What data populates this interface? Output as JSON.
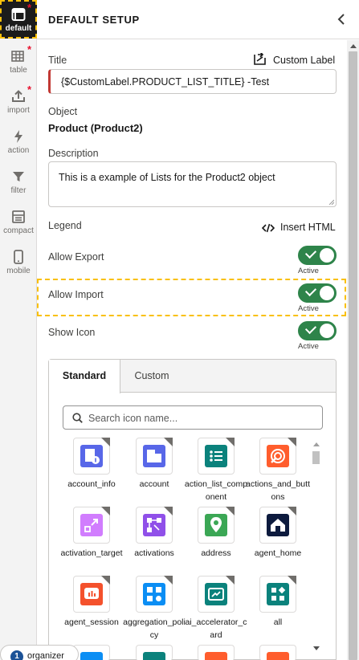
{
  "rail": {
    "items": [
      {
        "label": "default",
        "icon": "layout-icon",
        "active": true,
        "starred": true
      },
      {
        "label": "table",
        "icon": "table-icon",
        "starred": true
      },
      {
        "label": "import",
        "icon": "upload-icon",
        "starred": true
      },
      {
        "label": "action",
        "icon": "bolt-icon"
      },
      {
        "label": "filter",
        "icon": "filter-icon"
      },
      {
        "label": "compact",
        "icon": "compact-icon"
      },
      {
        "label": "mobile",
        "icon": "mobile-icon"
      }
    ]
  },
  "header": {
    "title": "DEFAULT SETUP"
  },
  "title_field": {
    "label": "Title",
    "custom_label_link": "Custom Label",
    "value": "{$CustomLabel.PRODUCT_LIST_TITLE} -Test"
  },
  "object": {
    "label": "Object",
    "value": "Product (Product2)"
  },
  "description": {
    "label": "Description",
    "value": "This is a example of Lists for the Product2 object"
  },
  "legend": {
    "label": "Legend",
    "insert_html": "Insert HTML"
  },
  "toggles": [
    {
      "label": "Allow Export",
      "status": "Active"
    },
    {
      "label": "Allow Import",
      "status": "Active"
    },
    {
      "label": "Show Icon",
      "status": "Active"
    }
  ],
  "icon_picker": {
    "tabs": [
      "Standard",
      "Custom"
    ],
    "search_placeholder": "Search icon name...",
    "icons": [
      {
        "name": "account_info",
        "color": "#5867e8"
      },
      {
        "name": "account",
        "color": "#5867e8"
      },
      {
        "name": "action_list_component",
        "color": "#0b827c"
      },
      {
        "name": "actions_and_buttons",
        "color": "#ff5d2d"
      },
      {
        "name": "activation_target",
        "color": "#d17dfe"
      },
      {
        "name": "activations",
        "color": "#9050e9"
      },
      {
        "name": "address",
        "color": "#3ba755"
      },
      {
        "name": "agent_home",
        "color": "#0d1b3e"
      },
      {
        "name": "agent_session",
        "color": "#f4512c"
      },
      {
        "name": "aggregation_policy",
        "color": "#0b8ef4"
      },
      {
        "name": "ai_accelerator_card",
        "color": "#0b827c"
      },
      {
        "name": "all",
        "color": "#0b827c"
      }
    ],
    "row4_colors": [
      "#0b8ef4",
      "#0b827c",
      "#ff5d2d",
      "#ff5d2d"
    ]
  },
  "organizer": {
    "label": "organizer"
  },
  "colors": {
    "accent_green": "#2e844a",
    "highlight": "#f9c00b",
    "error_bar": "#c23934"
  }
}
